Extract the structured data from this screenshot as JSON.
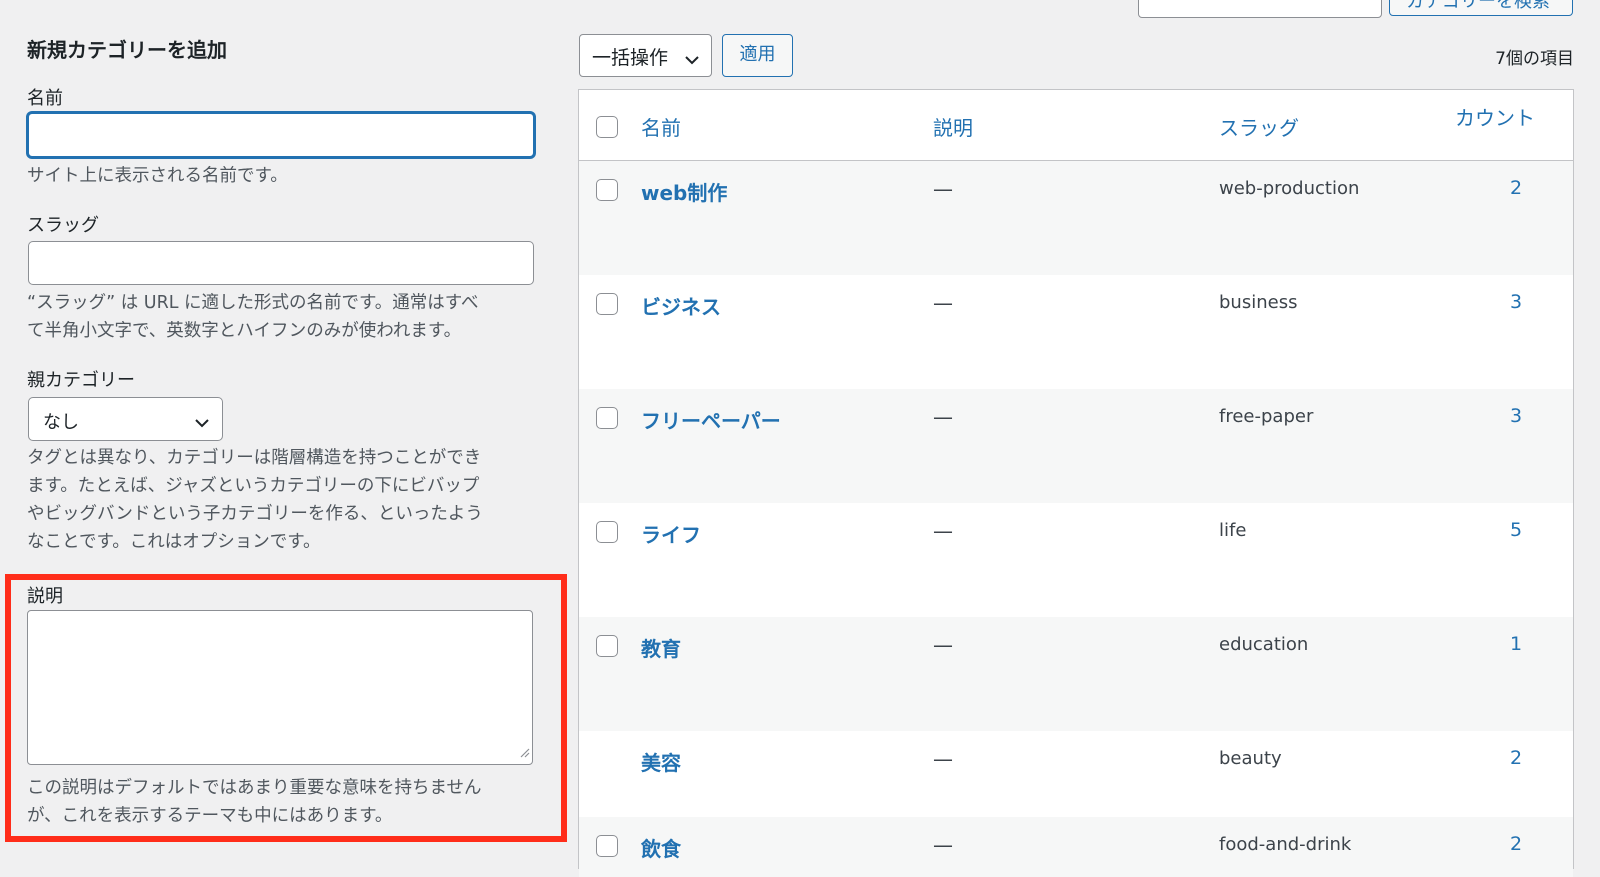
{
  "search": {
    "button_label": "カテゴリーを検索"
  },
  "form": {
    "title": "新規カテゴリーを追加",
    "name_label": "名前",
    "name_help": "サイト上に表示される名前です。",
    "slug_label": "スラッグ",
    "slug_help_1": "“スラッグ” は URL に適した形式の名前です。通常はすべ",
    "slug_help_2": "て半角小文字で、英数字とハイフンのみが使われます。",
    "parent_label": "親カテゴリー",
    "parent_value": "なし",
    "parent_help_1": "タグとは異なり、カテゴリーは階層構造を持つことができ",
    "parent_help_2": "ます。たとえば、ジャズというカテゴリーの下にビバップ",
    "parent_help_3": "やビッグバンドという子カテゴリーを作る、といったよう",
    "parent_help_4": "なことです。これはオプションです。",
    "description_label": "説明",
    "description_help_1": "この説明はデフォルトではあまり重要な意味を持ちません",
    "description_help_2": "が、これを表示するテーマも中にはあります。"
  },
  "toolbar": {
    "bulk_action": "一括操作",
    "apply": "適用",
    "item_count": "7個の項目"
  },
  "table": {
    "headers": {
      "name": "名前",
      "description": "説明",
      "slug": "スラッグ",
      "count": "カウント"
    },
    "rows": [
      {
        "name": "web制作",
        "description": "—",
        "slug": "web-production",
        "count": "2",
        "checkbox": true
      },
      {
        "name": "ビジネス",
        "description": "—",
        "slug": "business",
        "count": "3",
        "checkbox": true
      },
      {
        "name": "フリーペーパー",
        "description": "—",
        "slug": "free-paper",
        "count": "3",
        "checkbox": true
      },
      {
        "name": "ライフ",
        "description": "—",
        "slug": "life",
        "count": "5",
        "checkbox": true
      },
      {
        "name": "教育",
        "description": "—",
        "slug": "education",
        "count": "1",
        "checkbox": true
      },
      {
        "name": "美容",
        "description": "—",
        "slug": "beauty",
        "count": "2",
        "checkbox": false
      },
      {
        "name": "飲食",
        "description": "—",
        "slug": "food-and-drink",
        "count": "2",
        "checkbox": true
      }
    ]
  },
  "colors": {
    "accent": "#2271b1",
    "highlight": "#ff2d1a"
  },
  "icons": {
    "select_arrow": "chevron-down-icon",
    "resize": "resize-handle-icon"
  }
}
